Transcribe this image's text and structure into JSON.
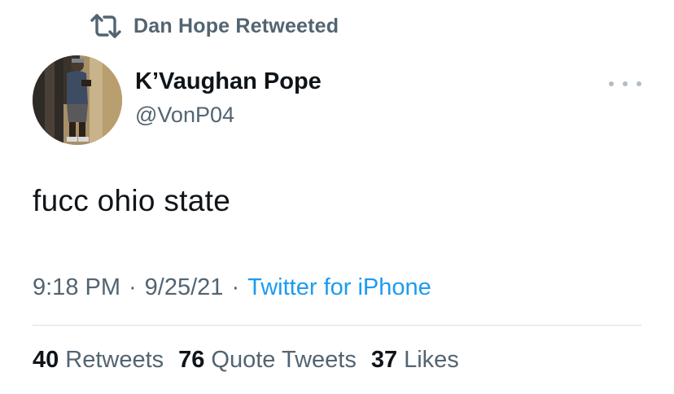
{
  "social_context": {
    "icon": "retweet-icon",
    "text": "Dan Hope Retweeted"
  },
  "author": {
    "display_name": "K’Vaughan Pope",
    "handle": "@VonP04",
    "avatar": "profile-photo"
  },
  "tweet": {
    "text": "fucc ohio state"
  },
  "meta": {
    "time": "9:18 PM",
    "separator": "·",
    "date": "9/25/21",
    "source": "Twitter for iPhone"
  },
  "stats": {
    "retweets_count": "40",
    "retweets_label": "Retweets",
    "quote_tweets_count": "76",
    "quote_tweets_label": "Quote Tweets",
    "likes_count": "37",
    "likes_label": "Likes"
  },
  "colors": {
    "secondary_text": "#536471",
    "link": "#1d9bf0",
    "primary_text": "#0f1419",
    "divider": "#d8dee3"
  }
}
